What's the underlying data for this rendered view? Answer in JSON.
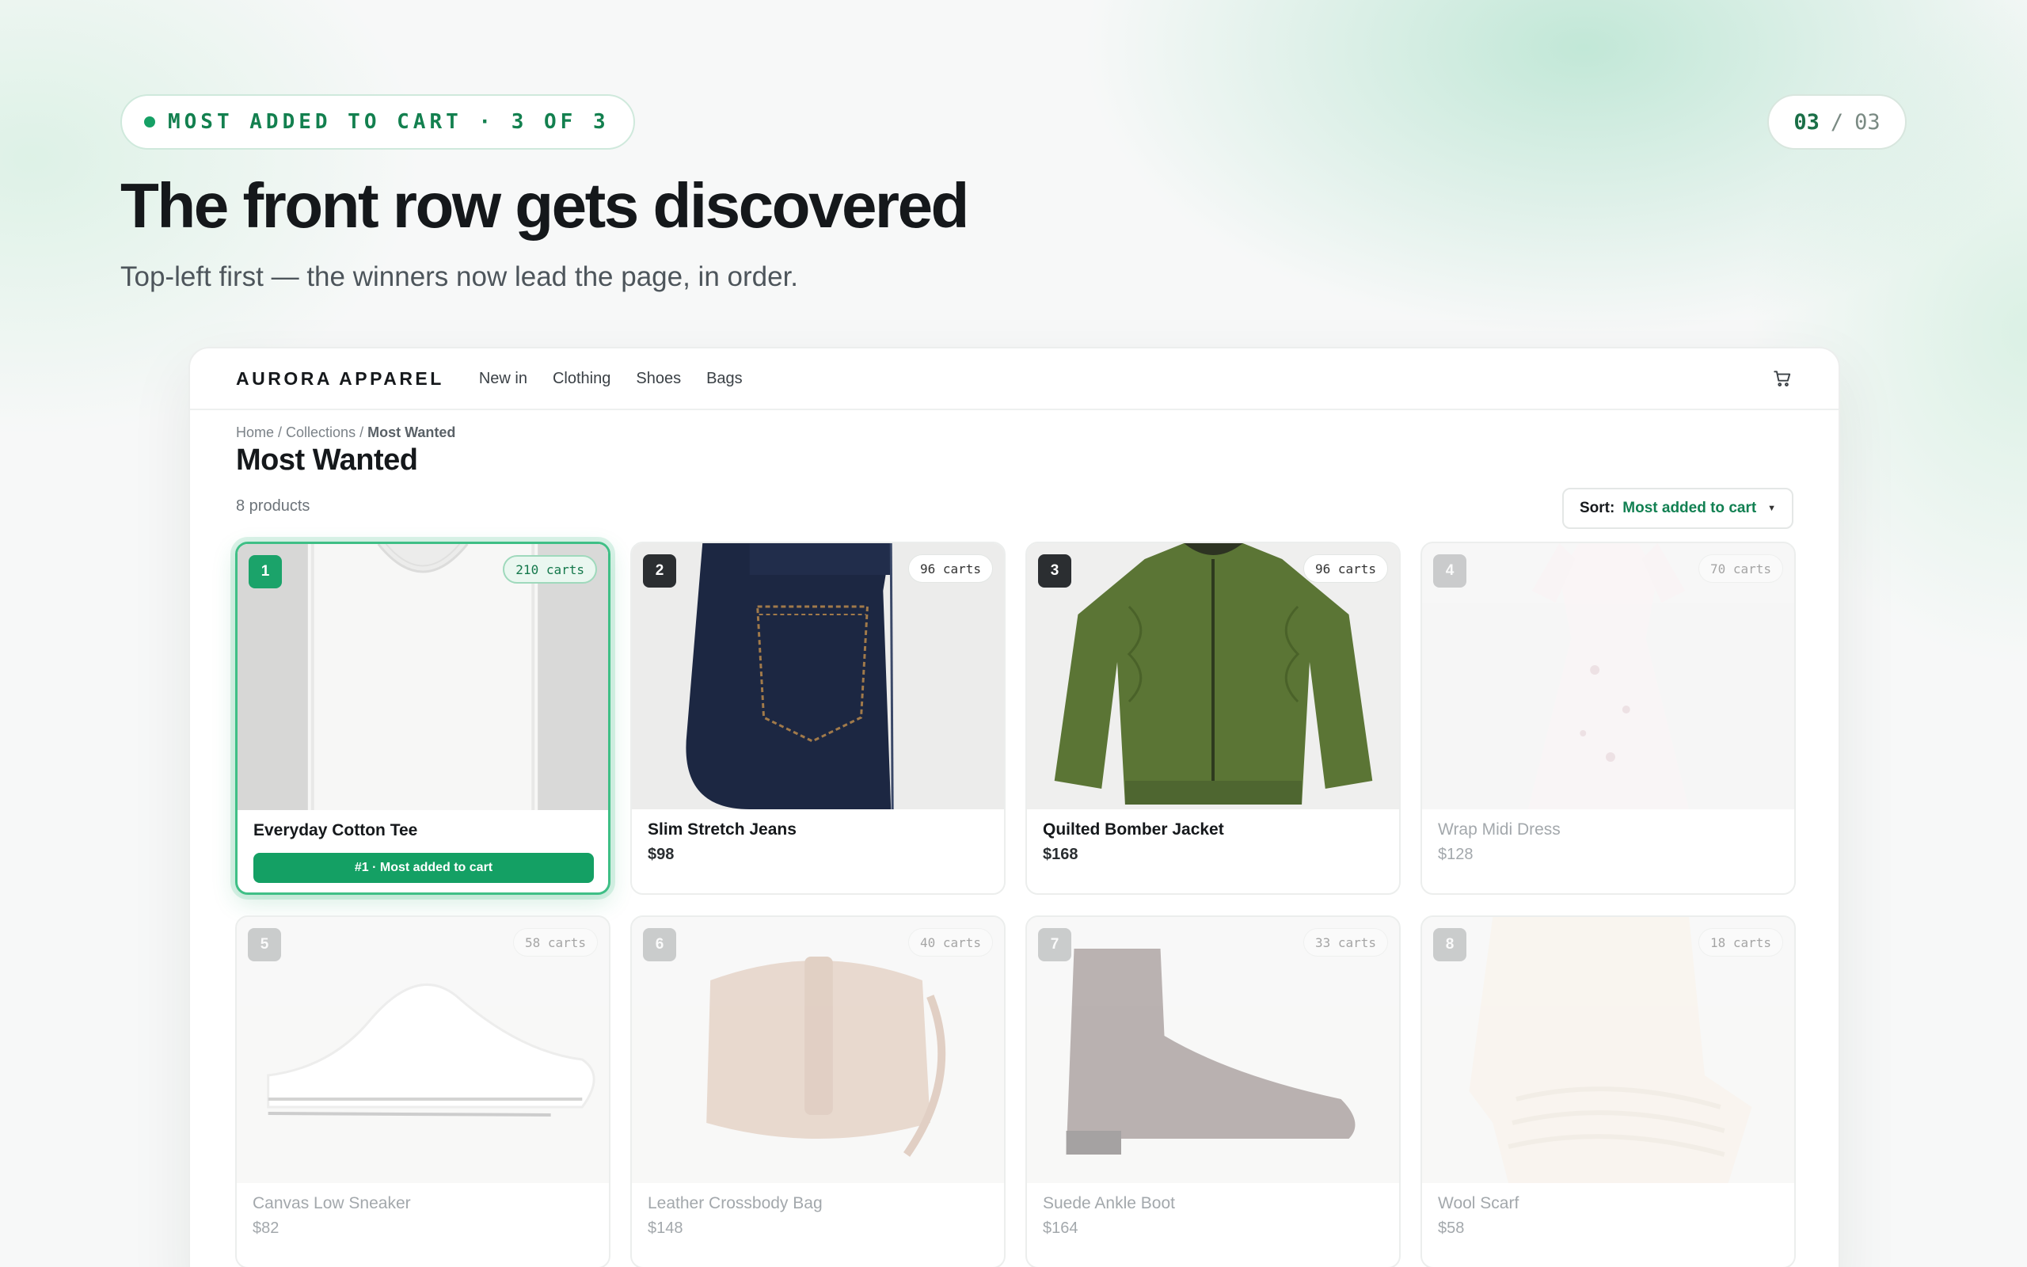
{
  "slide": {
    "eyebrow": "MOST ADDED TO CART · 3 OF 3",
    "counter_current": "03",
    "counter_sep": "/",
    "counter_total": "03",
    "headline": "The front row gets discovered",
    "subhead": "Top-left first — the winners now lead the page, in order."
  },
  "store": {
    "brand": "AURORA APPAREL",
    "nav": [
      "New in",
      "Clothing",
      "Shoes",
      "Bags"
    ],
    "breadcrumb": {
      "home": "Home",
      "sep1": " / ",
      "collections": "Collections",
      "sep2": " / ",
      "current": "Most Wanted"
    },
    "page_title": "Most Wanted",
    "product_count": "8 products",
    "sort": {
      "label": "Sort:",
      "value": "Most added to cart"
    }
  },
  "products": [
    {
      "rank": "1",
      "carts": "210 carts",
      "name": "Everyday Cotton Tee",
      "price": "",
      "badge": "#1 · Most added to cart",
      "icon": "tshirt-image"
    },
    {
      "rank": "2",
      "carts": "96 carts",
      "name": "Slim Stretch Jeans",
      "price": "$98",
      "icon": "jeans-image"
    },
    {
      "rank": "3",
      "carts": "96 carts",
      "name": "Quilted Bomber Jacket",
      "price": "$168",
      "icon": "jacket-image"
    },
    {
      "rank": "4",
      "carts": "70 carts",
      "name": "Wrap Midi Dress",
      "price": "$128",
      "icon": "dress-image"
    },
    {
      "rank": "5",
      "carts": "58 carts",
      "name": "Canvas Low Sneaker",
      "price": "$82",
      "icon": "sneaker-image"
    },
    {
      "rank": "6",
      "carts": "40 carts",
      "name": "Leather Crossbody Bag",
      "price": "$148",
      "icon": "bag-image"
    },
    {
      "rank": "7",
      "carts": "33 carts",
      "name": "Suede Ankle Boot",
      "price": "$164",
      "icon": "boot-image"
    },
    {
      "rank": "8",
      "carts": "18 carts",
      "name": "Wool Scarf",
      "price": "$58",
      "icon": "scarf-image"
    }
  ],
  "colors": {
    "accent": "#14a064",
    "accent_text": "#128052",
    "dark_rank": "#2b2e31"
  }
}
